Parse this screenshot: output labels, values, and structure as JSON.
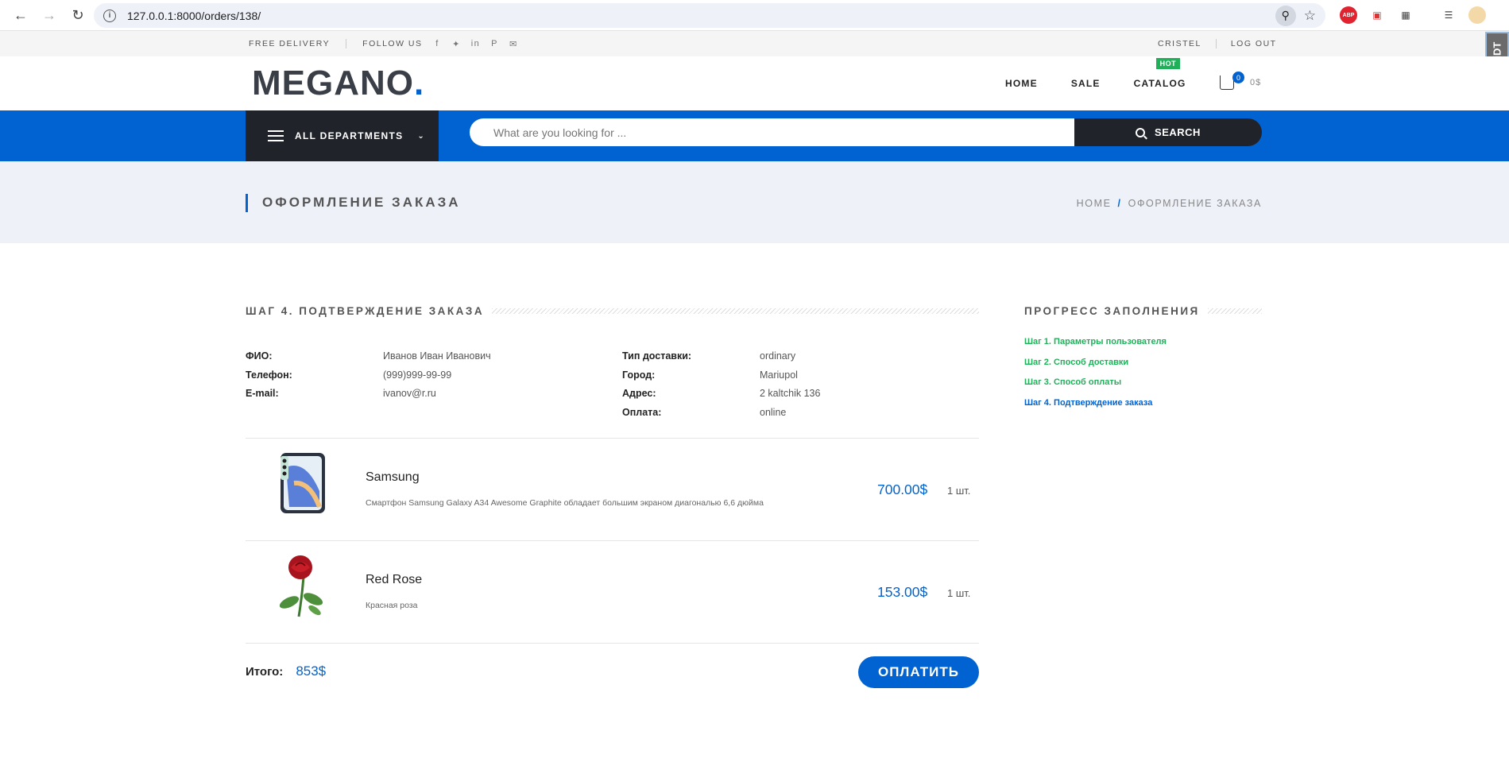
{
  "browser": {
    "url": "127.0.0.1:8000/orders/138/"
  },
  "topbar": {
    "free_delivery": "FREE DELIVERY",
    "follow_us": "FOLLOW US",
    "user": "CRISTEL",
    "logout": "LOG OUT"
  },
  "ext_didt": "DiDT",
  "header": {
    "logo_text": "MEGANO",
    "logo_dot": ".",
    "nav": {
      "home": "HOME",
      "sale": "SALE",
      "catalog": "CATALOG",
      "hot": "HOT"
    },
    "cart_count": "0",
    "cart_total": "0$"
  },
  "bluebar": {
    "departments": "ALL DEPARTMENTS",
    "search_placeholder": "What are you looking for ...",
    "search_button": "SEARCH"
  },
  "page": {
    "title": "ОФОРМЛЕНИЕ ЗАКАЗА",
    "breadcrumb_home": "HOME",
    "breadcrumb_sep": "/",
    "breadcrumb_current": "ОФОРМЛЕНИЕ ЗАКАЗА"
  },
  "order": {
    "heading": "ШАГ 4. ПОДТВЕРЖДЕНИЕ ЗАКАЗА",
    "left": [
      {
        "label": "ФИО:",
        "value": "Иванов Иван Иванович"
      },
      {
        "label": "Телефон:",
        "value": "(999)999-99-99"
      },
      {
        "label": "E-mail:",
        "value": "ivanov@r.ru"
      }
    ],
    "right": [
      {
        "label": "Тип доставки:",
        "value": "ordinary"
      },
      {
        "label": "Город:",
        "value": "Mariupol"
      },
      {
        "label": "Адрес:",
        "value": "2 kaltchik 136"
      },
      {
        "label": "Оплата:",
        "value": "online"
      }
    ],
    "products": [
      {
        "name": "Samsung",
        "description": "Смартфон Samsung Galaxy A34 Awesome Graphite обладает большим экраном диагональю 6,6 дюйма",
        "price": "700.00$",
        "qty": "1 шт."
      },
      {
        "name": "Red Rose",
        "description": "Красная роза",
        "price": "153.00$",
        "qty": "1 шт."
      }
    ],
    "total_label": "Итого:",
    "total_value": "853$",
    "pay_button": "ОПЛАТИТЬ"
  },
  "progress": {
    "heading": "ПРОГРЕСС ЗАПОЛНЕНИЯ",
    "steps": [
      "Шаг 1. Параметры пользователя",
      "Шаг 2. Способ доставки",
      "Шаг 3. Способ оплаты",
      "Шаг 4. Подтверждение заказа"
    ]
  },
  "colors": {
    "accent": "#0063d1",
    "dark": "#20232a",
    "done_step": "#1eb15a"
  }
}
